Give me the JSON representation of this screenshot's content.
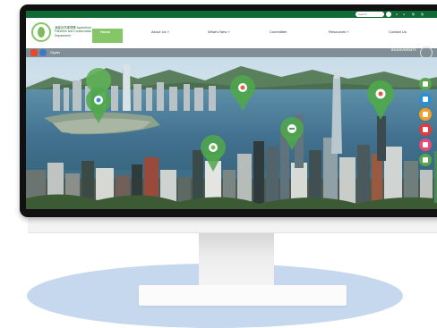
{
  "website": {
    "logo_text": "漁農自然護理署 Agriculture, Fisheries and Conservation Department",
    "nav": [
      {
        "label": "Home",
        "active": true
      },
      {
        "label": "About Us ˅",
        "active": false
      },
      {
        "label": "What's New ˅",
        "active": false
      },
      {
        "label": "Committee",
        "active": false
      },
      {
        "label": "Resources ˅",
        "active": false
      },
      {
        "label": "Contact Us",
        "active": false
      }
    ],
    "search_placeholder": "Search",
    "top_controls": [
      "A",
      "A",
      "繁",
      "简"
    ],
    "subnav_label": "Sights",
    "side_brand": "BIODIVERSITY",
    "brand_color": "#0f6a35",
    "accent_color": "#85c666",
    "dock_icons": [
      {
        "icon": "map-pin-icon",
        "color": "#5aa64c"
      },
      {
        "icon": "bus-icon",
        "color": "#2a8fd6"
      },
      {
        "icon": "search-icon",
        "color": "#f0a12a"
      },
      {
        "icon": "play-icon",
        "color": "#e23b3b"
      },
      {
        "icon": "chat-icon",
        "color": "#e84a7a"
      },
      {
        "icon": "up-arrow-icon",
        "color": "#5aa64c"
      }
    ],
    "map_pins": [
      {
        "icon": "bird-icon"
      },
      {
        "icon": "flower-icon"
      },
      {
        "icon": "leaf-icon"
      },
      {
        "icon": "fish-icon"
      },
      {
        "icon": "butterfly-icon"
      }
    ]
  }
}
